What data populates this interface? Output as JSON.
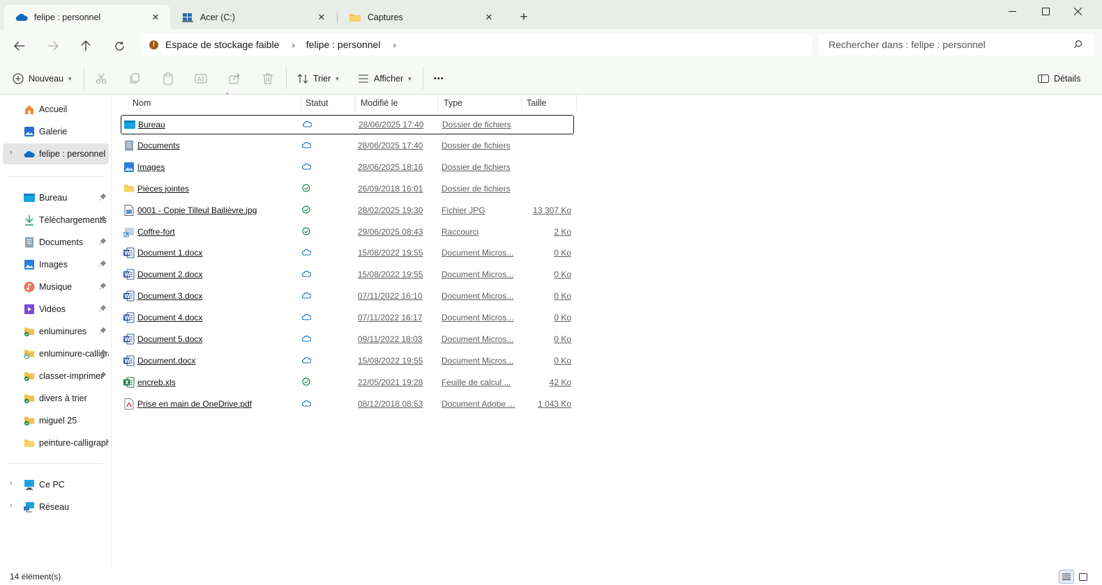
{
  "tabs": [
    {
      "label": "felipe : personnel",
      "icon": "onedrive-cloud-icon",
      "active": true
    },
    {
      "label": "Acer (C:)",
      "icon": "drive-icon",
      "active": false
    },
    {
      "label": "Captures",
      "icon": "folder-icon",
      "active": false
    }
  ],
  "window_controls": {
    "minimize": "minimize-icon",
    "maximize": "maximize-icon",
    "close": "close-icon"
  },
  "address": {
    "warning": "!",
    "crumbs": [
      "Espace de stockage faible",
      "felipe : personnel"
    ]
  },
  "search": {
    "placeholder": "Rechercher dans : felipe : personnel"
  },
  "toolbar": {
    "new_label": "Nouveau",
    "sort_label": "Trier",
    "view_label": "Afficher",
    "more_label": "•••",
    "details_label": "Détails"
  },
  "sidebar": {
    "top": [
      {
        "label": "Accueil",
        "icon": "home-icon"
      },
      {
        "label": "Galerie",
        "icon": "gallery-icon"
      },
      {
        "label": "felipe : personnel",
        "icon": "onedrive-cloud-icon",
        "selected": true
      }
    ],
    "quick": [
      {
        "label": "Bureau",
        "icon": "desktop-folder-icon",
        "pinned": true
      },
      {
        "label": "Téléchargements",
        "icon": "download-icon",
        "pinned": true
      },
      {
        "label": "Documents",
        "icon": "documents-icon",
        "pinned": true
      },
      {
        "label": "Images",
        "icon": "pictures-icon",
        "pinned": true
      },
      {
        "label": "Musique",
        "icon": "music-icon",
        "pinned": true
      },
      {
        "label": "Vidéos",
        "icon": "videos-icon",
        "pinned": true
      },
      {
        "label": "enluminures",
        "icon": "folder-synced-icon",
        "pinned": true
      },
      {
        "label": "enluminure-calligraphie",
        "icon": "folder-sync-icon",
        "pinned": true
      },
      {
        "label": "classer-imprimer",
        "icon": "folder-synced-icon",
        "pinned": true
      },
      {
        "label": "divers à trier",
        "icon": "folder-synced-icon",
        "pinned": false
      },
      {
        "label": "miguel 25",
        "icon": "folder-synced-icon",
        "pinned": false
      },
      {
        "label": "peinture-calligraphie",
        "icon": "folder-icon",
        "pinned": false
      }
    ],
    "bottom": [
      {
        "label": "Ce PC",
        "icon": "pc-icon"
      },
      {
        "label": "Réseau",
        "icon": "network-icon"
      }
    ]
  },
  "columns": {
    "name": "Nom",
    "status": "Statut",
    "modified": "Modifié le",
    "type": "Type",
    "size": "Taille"
  },
  "files": [
    {
      "name": "Bureau",
      "status": "cloud",
      "modified": "28/06/2025 17:40",
      "type": "Dossier de fichiers",
      "size": "",
      "icon": "desktop-folder-icon"
    },
    {
      "name": "Documents",
      "status": "cloud",
      "modified": "28/06/2025 17:40",
      "type": "Dossier de fichiers",
      "size": "",
      "icon": "documents-icon"
    },
    {
      "name": "Images",
      "status": "cloud",
      "modified": "28/06/2025 18:16",
      "type": "Dossier de fichiers",
      "size": "",
      "icon": "pictures-icon"
    },
    {
      "name": "Pièces jointes",
      "status": "synced",
      "modified": "26/09/2018 16:01",
      "type": "Dossier de fichiers",
      "size": "",
      "icon": "folder-icon"
    },
    {
      "name": "0001 - Copie Tilleul Bailièvre.jpg",
      "status": "synced",
      "modified": "28/02/2025 19:30",
      "type": "Fichier JPG",
      "size": "13 307 Ko",
      "icon": "image-file-icon"
    },
    {
      "name": "Coffre-fort",
      "status": "synced",
      "modified": "29/06/2025 08:43",
      "type": "Raccourci",
      "size": "2 Ko",
      "icon": "shortcut-icon"
    },
    {
      "name": "Document 1.docx",
      "status": "cloud",
      "modified": "15/08/2022 19:55",
      "type": "Document Micros...",
      "size": "0 Ko",
      "icon": "word-icon"
    },
    {
      "name": "Document 2.docx",
      "status": "cloud",
      "modified": "15/08/2022 19:55",
      "type": "Document Micros...",
      "size": "0 Ko",
      "icon": "word-icon"
    },
    {
      "name": "Document 3.docx",
      "status": "cloud",
      "modified": "07/11/2022 16:10",
      "type": "Document Micros...",
      "size": "0 Ko",
      "icon": "word-icon"
    },
    {
      "name": "Document 4.docx",
      "status": "cloud",
      "modified": "07/11/2022 16:17",
      "type": "Document Micros...",
      "size": "0 Ko",
      "icon": "word-icon"
    },
    {
      "name": "Document 5.docx",
      "status": "cloud",
      "modified": "09/11/2022 18:03",
      "type": "Document Micros...",
      "size": "0 Ko",
      "icon": "word-icon"
    },
    {
      "name": "Document.docx",
      "status": "cloud",
      "modified": "15/08/2022 19:55",
      "type": "Document Micros...",
      "size": "0 Ko",
      "icon": "word-icon"
    },
    {
      "name": "encreb.xls",
      "status": "synced",
      "modified": "22/05/2021 19:28",
      "type": "Feuille de calcul ...",
      "size": "42 Ko",
      "icon": "excel-icon"
    },
    {
      "name": "Prise en main de OneDrive.pdf",
      "status": "cloud",
      "modified": "08/12/2018 08:53",
      "type": "Document Adobe ...",
      "size": "1 043 Ko",
      "icon": "pdf-icon"
    }
  ],
  "statusbar": {
    "count": "14 élément(s)"
  },
  "colors": {
    "accent": "#0f6cbd",
    "synced": "#1f8a4c",
    "folder": "#f2c14e",
    "titlebar": "#e9ede8"
  }
}
